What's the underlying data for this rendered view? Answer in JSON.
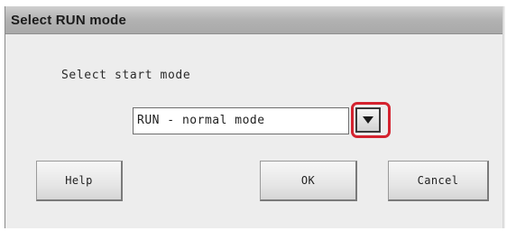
{
  "dialog": {
    "title": "Select RUN mode",
    "prompt": "Select start mode"
  },
  "mode_select": {
    "selected_value": "RUN - normal mode",
    "dropdown_icon": "triangle-down-icon",
    "highlight_color": "#d4232f"
  },
  "buttons": {
    "help_label": "Help",
    "ok_label": "OK",
    "cancel_label": "Cancel"
  }
}
